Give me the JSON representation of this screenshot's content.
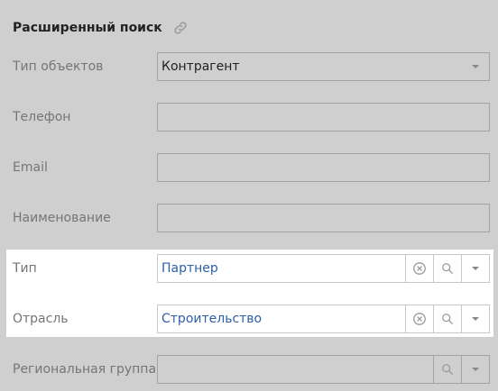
{
  "header": {
    "title": "Расширенный поиск",
    "link_icon": "link-icon"
  },
  "fields": [
    {
      "label": "Тип объектов",
      "value": "Контрагент"
    },
    {
      "label": "Телефон",
      "value": ""
    },
    {
      "label": "Email",
      "value": ""
    },
    {
      "label": "Наименование",
      "value": ""
    },
    {
      "label": "Тип",
      "value": "Партнер"
    },
    {
      "label": "Отрасль",
      "value": "Строительство"
    },
    {
      "label": "Региональная группа",
      "value": ""
    }
  ],
  "colors": {
    "background": "#cfcfcf",
    "highlight": "#ffffff",
    "link_value": "#2b5fa7"
  }
}
